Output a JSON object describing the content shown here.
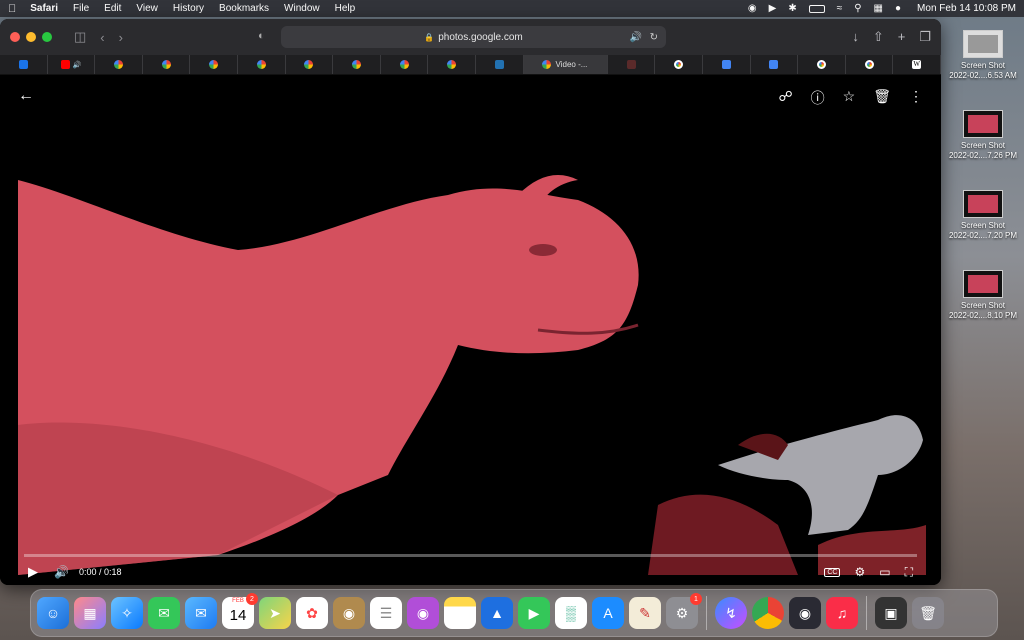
{
  "menubar": {
    "app": "Safari",
    "items": [
      "File",
      "Edit",
      "View",
      "History",
      "Bookmarks",
      "Window",
      "Help"
    ],
    "clock": "Mon Feb 14  10:08 PM"
  },
  "browser": {
    "url": "photos.google.com",
    "tabs": [
      {
        "icon": "calendar-icon",
        "title": ""
      },
      {
        "icon": "youtube-icon",
        "title": ""
      },
      {
        "icon": "google-photos-icon",
        "title": ""
      },
      {
        "icon": "google-photos-icon",
        "title": ""
      },
      {
        "icon": "google-photos-icon",
        "title": ""
      },
      {
        "icon": "google-photos-icon",
        "title": ""
      },
      {
        "icon": "google-photos-icon",
        "title": ""
      },
      {
        "icon": "google-photos-icon",
        "title": ""
      },
      {
        "icon": "google-photos-icon",
        "title": ""
      },
      {
        "icon": "google-photos-icon",
        "title": ""
      },
      {
        "icon": "wordpress-icon",
        "title": ""
      },
      {
        "icon": "google-photos-icon",
        "title": "Video -..."
      },
      {
        "icon": "site-icon",
        "title": ""
      },
      {
        "icon": "google-icon",
        "title": ""
      },
      {
        "icon": "docs-icon",
        "title": ""
      },
      {
        "icon": "docs-icon",
        "title": ""
      },
      {
        "icon": "google-icon",
        "title": ""
      },
      {
        "icon": "google-icon",
        "title": ""
      },
      {
        "icon": "wikipedia-icon",
        "title": ""
      }
    ]
  },
  "player": {
    "time": "0:00 / 0:18",
    "progress": 0,
    "cc_label": "CC"
  },
  "desktop_files": [
    {
      "name": "Screen Shot",
      "sub": "2022-02....6.53 AM"
    },
    {
      "name": "Screen Shot",
      "sub": "2022-02....7.26 PM"
    },
    {
      "name": "Screen Shot",
      "sub": "2022-02....7.20 PM"
    },
    {
      "name": "Screen Shot",
      "sub": "2022-02....8.10 PM"
    }
  ],
  "dock": {
    "calendar_month": "FEB",
    "calendar_day": "14",
    "calendar_badge": "2",
    "settings_badge": "1"
  },
  "colors": {
    "accent": "#5aa0ff",
    "dinosaur": "#d4505e",
    "window_bg": "#000000"
  }
}
